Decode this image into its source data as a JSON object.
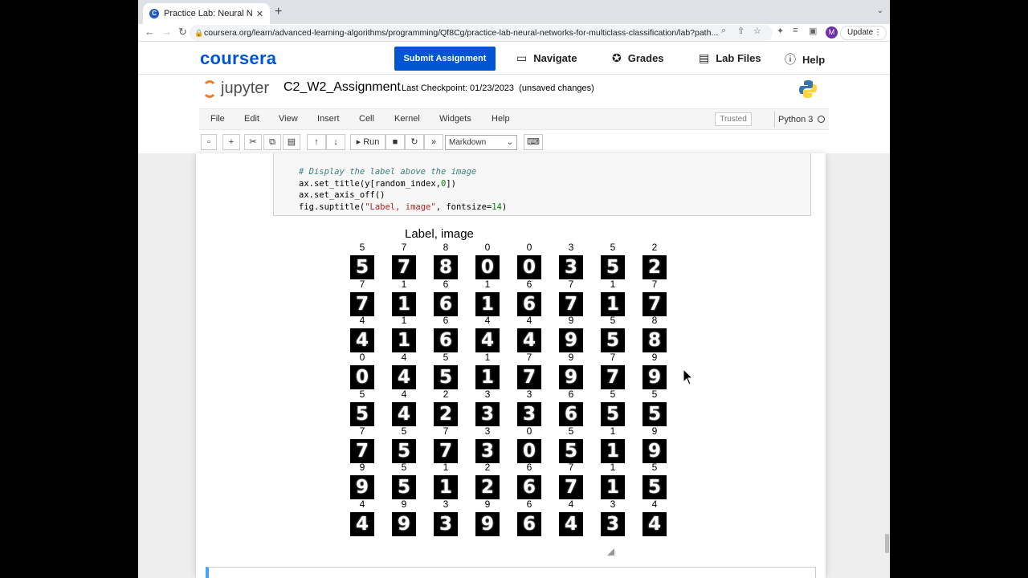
{
  "browser": {
    "tab_title": "Practice Lab: Neural Networks",
    "tab_favicon": "C",
    "url": "coursera.org/learn/advanced-learning-algorithms/programming/Qf8Cg/practice-lab-neural-networks-for-multiclass-classification/lab?path...",
    "avatar_letter": "M",
    "update_label": "Update"
  },
  "coursera": {
    "logo": "coursera",
    "submit_label": "Submit Assignment",
    "nav": [
      {
        "label": "Navigate",
        "icon": "navigate-icon"
      },
      {
        "label": "Grades",
        "icon": "grades-icon"
      },
      {
        "label": "Lab Files",
        "icon": "lab-files-icon"
      },
      {
        "label": "Help",
        "icon": "help-icon"
      }
    ],
    "brand_color": "#0056d2"
  },
  "jupyter": {
    "logo_text": "jupyter",
    "notebook_name": "C2_W2_Assignment",
    "checkpoint": "Last Checkpoint: 01/23/2023",
    "save_state": "(unsaved changes)",
    "menus": [
      "File",
      "Edit",
      "View",
      "Insert",
      "Cell",
      "Kernel",
      "Widgets",
      "Help"
    ],
    "trusted": "Trusted",
    "kernel_name": "Python 3",
    "run_label": "Run",
    "cell_type": "Markdown"
  },
  "code_cell": {
    "comment": "# Display the label above the image",
    "line1": "ax.set_title(y[random_index,",
    "line1_num": "0",
    "line1_end": "])",
    "line2": "ax.set_axis_off()",
    "line3_a": "fig.suptitle(",
    "line3_str": "\"Label, image\"",
    "line3_b": ", fontsize=",
    "line3_num": "14",
    "line3_end": ")"
  },
  "figure": {
    "suptitle": "Label, image",
    "labels": [
      [
        "5",
        "7",
        "8",
        "0",
        "0",
        "3",
        "5",
        "2"
      ],
      [
        "7",
        "1",
        "6",
        "1",
        "6",
        "7",
        "1",
        "7"
      ],
      [
        "4",
        "1",
        "6",
        "4",
        "4",
        "9",
        "5",
        "8"
      ],
      [
        "0",
        "4",
        "5",
        "1",
        "7",
        "9",
        "7",
        "9"
      ],
      [
        "5",
        "4",
        "2",
        "3",
        "3",
        "6",
        "5",
        "5"
      ],
      [
        "7",
        "5",
        "7",
        "3",
        "0",
        "5",
        "1",
        "9"
      ],
      [
        "9",
        "5",
        "1",
        "2",
        "6",
        "7",
        "1",
        "5"
      ],
      [
        "4",
        "9",
        "3",
        "9",
        "6",
        "4",
        "3",
        "4"
      ]
    ],
    "digits": [
      [
        "5",
        "7",
        "8",
        "0",
        "0",
        "3",
        "5",
        "2"
      ],
      [
        "7",
        "1",
        "6",
        "1",
        "6",
        "7",
        "1",
        "7"
      ],
      [
        "4",
        "1",
        "6",
        "4",
        "4",
        "9",
        "5",
        "8"
      ],
      [
        "0",
        "4",
        "5",
        "1",
        "7",
        "9",
        "7",
        "9"
      ],
      [
        "5",
        "4",
        "2",
        "3",
        "3",
        "6",
        "5",
        "5"
      ],
      [
        "7",
        "5",
        "7",
        "3",
        "0",
        "5",
        "1",
        "9"
      ],
      [
        "9",
        "5",
        "1",
        "2",
        "6",
        "7",
        "1",
        "5"
      ],
      [
        "4",
        "9",
        "3",
        "9",
        "6",
        "4",
        "3",
        "4"
      ]
    ]
  }
}
